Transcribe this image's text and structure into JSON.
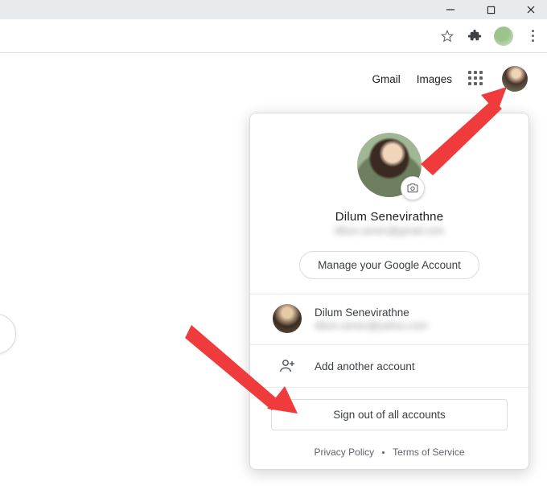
{
  "window": {
    "minimize_label": "Minimize",
    "maximize_label": "Maximize",
    "close_label": "Close"
  },
  "toolbar": {
    "star_label": "Bookmark this tab",
    "extension_label": "Extensions",
    "profile_label": "Chrome profile",
    "menu_label": "Customize and control"
  },
  "gnav": {
    "gmail": "Gmail",
    "images": "Images",
    "apps_label": "Google apps",
    "avatar_label": "Google Account"
  },
  "popup": {
    "camera_label": "Change profile photo",
    "name": "Dilum Senevirathne",
    "email": "dilum.senev@gmail.com",
    "manage_label": "Manage your Google Account",
    "accounts": [
      {
        "name": "Dilum Senevirathne",
        "email": "dilum.senev@yahoo.com"
      }
    ],
    "add_label": "Add another account",
    "signout_label": "Sign out of all accounts",
    "privacy": "Privacy Policy",
    "terms": "Terms of Service"
  },
  "colors": {
    "arrow": "#ef3b3b"
  }
}
